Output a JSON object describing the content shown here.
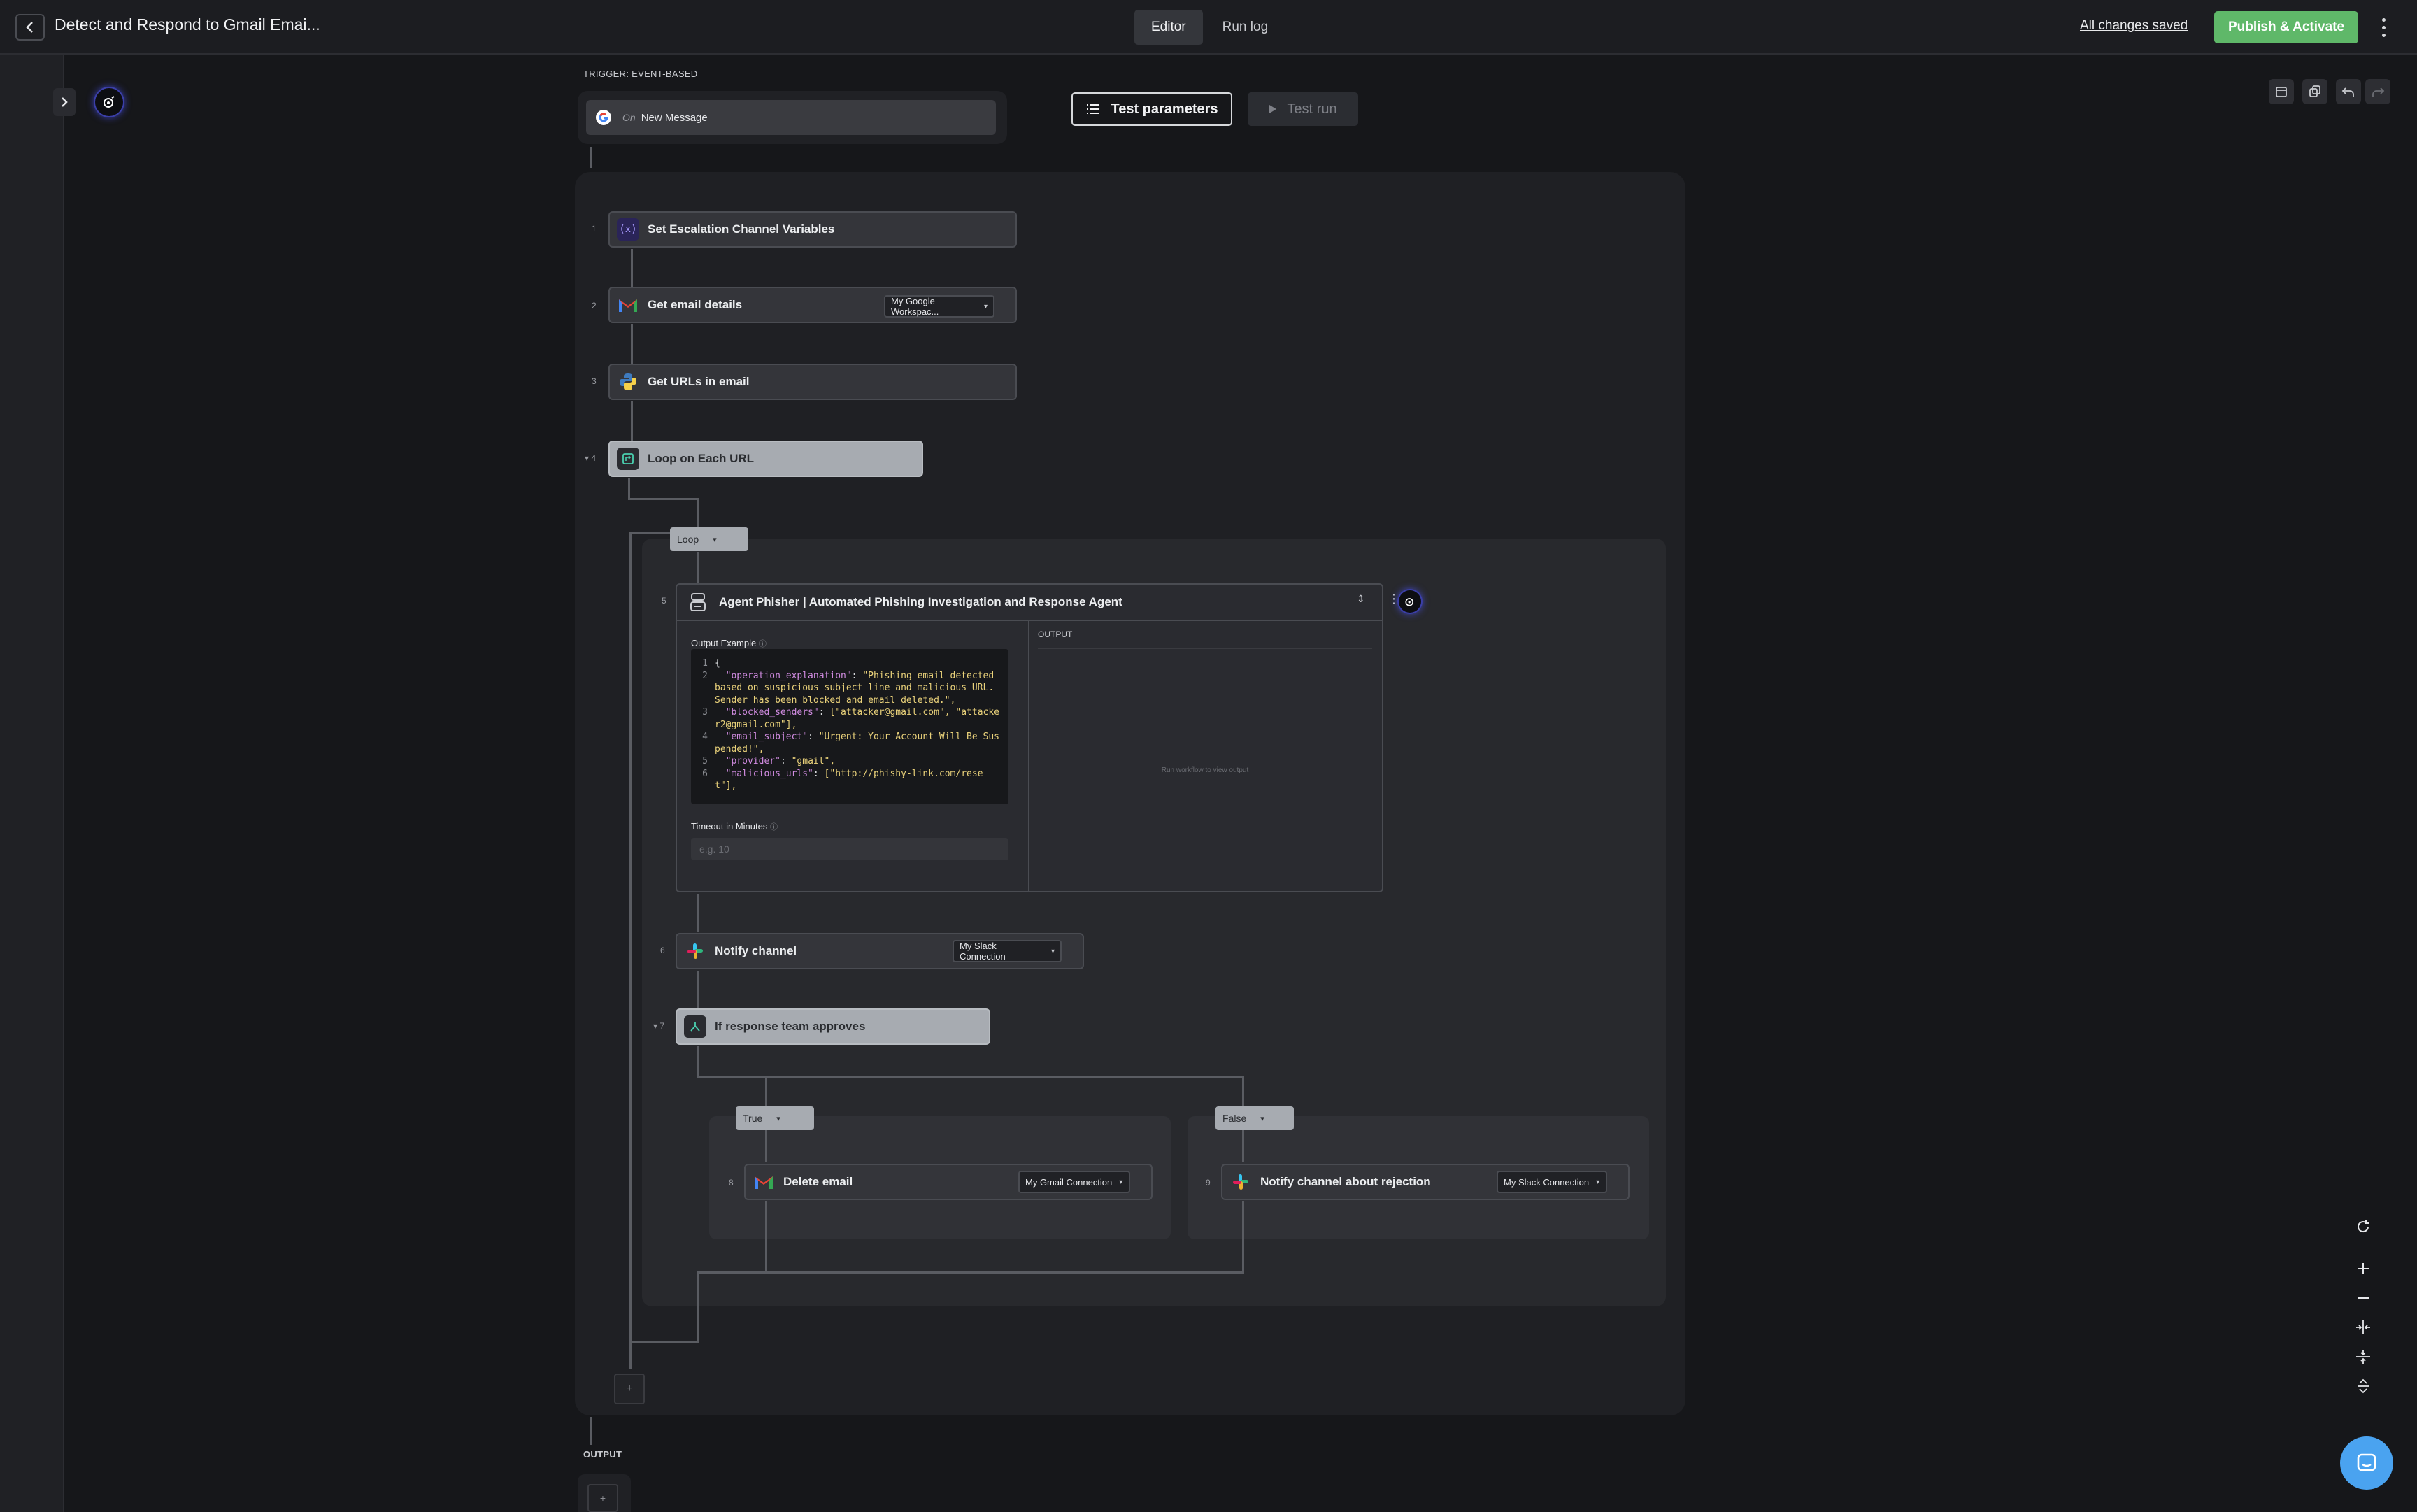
{
  "header": {
    "title": "Detect and Respond to Gmail Emai...",
    "tabs": [
      "Editor",
      "Run log"
    ],
    "saved_status": "All changes saved",
    "publish_label": "Publish & Activate"
  },
  "toolbar": {
    "test_parameters": "Test parameters",
    "test_run": "Test run"
  },
  "trigger": {
    "caption": "TRIGGER: EVENT-BASED",
    "event_prefix": "On",
    "event_name": "New Message"
  },
  "steps": [
    {
      "num": "1",
      "name": "Set Escalation Channel Variables"
    },
    {
      "num": "2",
      "name": "Get email details",
      "connection": "My Google Workspac..."
    },
    {
      "num": "3",
      "name": "Get URLs in email"
    },
    {
      "num": "4",
      "name": "Loop on Each URL"
    },
    {
      "num": "5",
      "name": "Agent Phisher | Automated Phishing Investigation and Response Agent"
    },
    {
      "num": "6",
      "name": "Notify channel",
      "connection": "My Slack Connection"
    },
    {
      "num": "7",
      "name": "If response team approves"
    },
    {
      "num": "8",
      "name": "Delete email",
      "connection": "My Gmail Connection"
    },
    {
      "num": "9",
      "name": "Notify channel about rejection",
      "connection": "My Slack Connection"
    }
  ],
  "loop_tag": "Loop",
  "branches": {
    "true_label": "True",
    "false_label": "False"
  },
  "agent": {
    "output_example_label": "Output Example",
    "code_lines": [
      {
        "n": "1",
        "text": "{"
      },
      {
        "n": "2",
        "key": "\"operation_explanation\"",
        "val": "\"Phishing email detected based on suspicious subject line and malicious URL. Sender has been blocked and email deleted.\","
      },
      {
        "n": "3",
        "key": "\"blocked_senders\"",
        "val": "[\"attacker@gmail.com\", \"attacker2@gmail.com\"],"
      },
      {
        "n": "4",
        "key": "\"email_subject\"",
        "val": "\"Urgent: Your Account Will Be Suspended!\","
      },
      {
        "n": "5",
        "key": "\"provider\"",
        "val": "\"gmail\","
      },
      {
        "n": "6",
        "key": "\"malicious_urls\"",
        "val": "[\"http://phishy-link.com/reset\"],"
      }
    ],
    "timeout_label": "Timeout in Minutes",
    "timeout_placeholder": "e.g. 10",
    "output_label": "OUTPUT",
    "output_empty": "Run workflow to view output"
  },
  "output_caption": "OUTPUT",
  "colors": {
    "publish": "#5fb869",
    "accent_ai": "#4c55ff",
    "chat": "#4aa3f0"
  }
}
